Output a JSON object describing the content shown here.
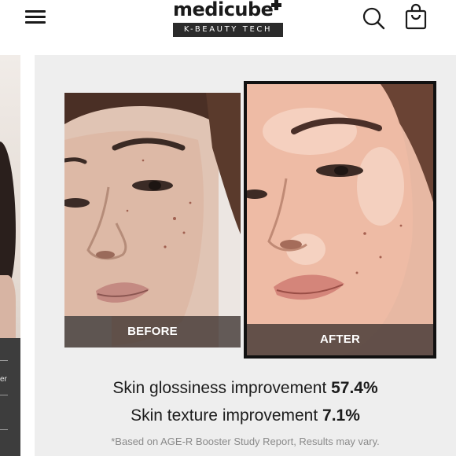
{
  "header": {
    "brand": "medicube",
    "tagline": "K-BEAUTY TECH",
    "icons": {
      "menu": "hamburger-menu-icon",
      "search": "search-icon",
      "cart": "shopping-bag-icon"
    }
  },
  "peek_slide": {
    "text": "er"
  },
  "comparison": {
    "before_label": "BEFORE",
    "after_label": "AFTER"
  },
  "stats": [
    {
      "label": "Skin glossiness improvement",
      "value": "57.4%"
    },
    {
      "label": "Skin texture improvement",
      "value": "7.1%"
    }
  ],
  "disclaimer": "*Based on AGE-R Booster Study Report, Results may vary.",
  "colors": {
    "header_bg": "#ffffff",
    "slide_bg": "#eeeeee",
    "text": "#1c1c1c",
    "label_overlay": "#3c3230",
    "after_frame": "#111111"
  }
}
